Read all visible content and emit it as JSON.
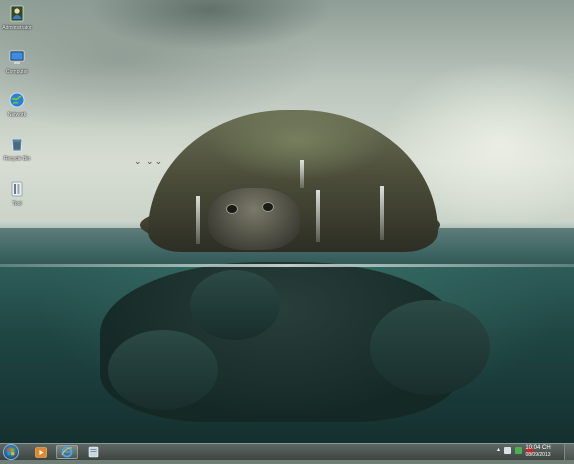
{
  "desktop": {
    "icons": [
      {
        "label": "Administrator",
        "icon": "user-folder-icon"
      },
      {
        "label": "Computer",
        "icon": "computer-icon"
      },
      {
        "label": "Network",
        "icon": "network-icon"
      },
      {
        "label": "Recycle Bin",
        "icon": "recycle-bin-icon"
      },
      {
        "label": "Tool",
        "icon": "tool-folder-icon"
      }
    ]
  },
  "taskbar": {
    "pinned": [
      {
        "icon": "media-player-icon",
        "active": false
      },
      {
        "icon": "internet-explorer-icon",
        "active": true
      },
      {
        "icon": "file-explorer-icon",
        "active": false
      }
    ],
    "tray": [
      "tray-arrow-icon",
      "network-tray-icon",
      "battery-tray-icon",
      "power-tray-icon"
    ],
    "clock": {
      "time": "10:04 CH",
      "date": "08/09/2013"
    }
  }
}
